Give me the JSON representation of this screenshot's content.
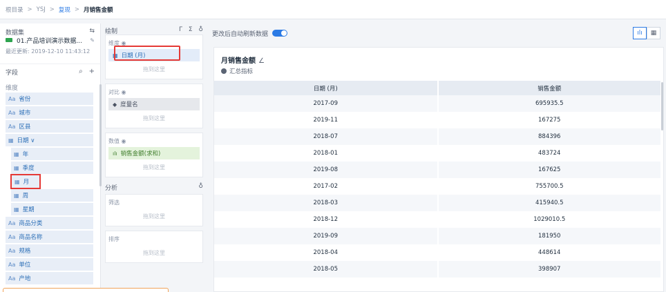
{
  "breadcrumb": {
    "root": "根目录",
    "sep": ">",
    "folder": "YSJ",
    "parent": "复现",
    "current": "月销售金额"
  },
  "left": {
    "dataset_label": "数据集",
    "dataset_name": "01.产品培训演示数据...",
    "updated": "最近更新: 2019-12-10 11:43:12",
    "fields_label": "字段",
    "dimension_label": "维度",
    "fields": [
      {
        "type": "Aa",
        "name": "省份"
      },
      {
        "type": "Aa",
        "name": "城市"
      },
      {
        "type": "Aa",
        "name": "区县"
      },
      {
        "type": "date",
        "name": "日期 ∨"
      },
      {
        "type": "date",
        "name": "年",
        "sub": true
      },
      {
        "type": "date",
        "name": "季度",
        "sub": true
      },
      {
        "type": "date",
        "name": "月",
        "sub": true,
        "highlight": true
      },
      {
        "type": "date",
        "name": "周",
        "sub": true
      },
      {
        "type": "date",
        "name": "星期",
        "sub": true
      },
      {
        "type": "Aa",
        "name": "商品分类"
      },
      {
        "type": "Aa",
        "name": "商品名称"
      },
      {
        "type": "Aa",
        "name": "规格"
      },
      {
        "type": "Aa",
        "name": "单位"
      },
      {
        "type": "Aa",
        "name": "产地"
      }
    ]
  },
  "mid": {
    "title": "绘制",
    "tools": [
      "Γ",
      "Σ",
      "♁"
    ],
    "dimension": {
      "title": "维度 ◉",
      "pill": "日期 (月)",
      "drop": "拖到这里"
    },
    "compare": {
      "title": "对比 ◉",
      "pill": "度量名",
      "drop": "拖到这里"
    },
    "value": {
      "title": "数值 ◉",
      "pill": "销售金额(求和)",
      "drop": "拖到这里"
    },
    "analysis": "分析",
    "filter": {
      "title": "筛选",
      "drop": "拖到这里"
    },
    "sort": {
      "title": "排序",
      "drop": "拖到这里"
    }
  },
  "right": {
    "auto_refresh": "更改后自动刷新数据",
    "chart_title": "月销售金额",
    "subtitle": "汇总指标",
    "columns": [
      "日期 (月)",
      "销售金额"
    ],
    "rows": [
      [
        "2017-09",
        "695935.5"
      ],
      [
        "2019-11",
        "167275"
      ],
      [
        "2018-07",
        "884396"
      ],
      [
        "2018-01",
        "483724"
      ],
      [
        "2019-08",
        "167625"
      ],
      [
        "2017-02",
        "755700.5"
      ],
      [
        "2018-03",
        "415940.5"
      ],
      [
        "2018-12",
        "1029010.5"
      ],
      [
        "2019-09",
        "181950"
      ],
      [
        "2018-04",
        "448614"
      ],
      [
        "2018-05",
        "398907"
      ]
    ]
  }
}
